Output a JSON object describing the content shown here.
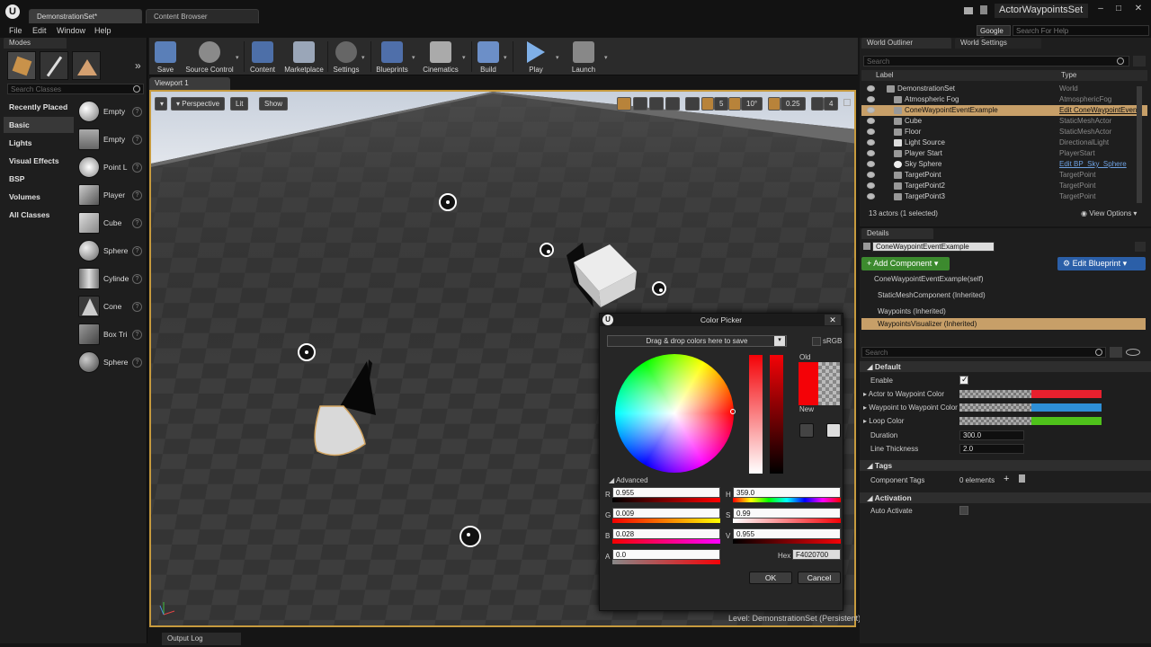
{
  "titlebar": {
    "tabs": [
      "DemonstrationSet*",
      "Content Browser"
    ],
    "project_name": "ActorWaypointsSet"
  },
  "menubar": {
    "items": [
      "File",
      "Edit",
      "Window",
      "Help"
    ],
    "google_label": "Google",
    "search_help_placeholder": "Search For Help"
  },
  "modes": {
    "tab_label": "Modes",
    "search_placeholder": "Search Classes",
    "categories": [
      "Recently Placed",
      "Basic",
      "Lights",
      "Visual Effects",
      "BSP",
      "Volumes",
      "All Classes"
    ],
    "items": [
      "Empty",
      "Empty",
      "Point L",
      "Player",
      "Cube",
      "Sphere",
      "Cylinde",
      "Cone",
      "Box Tri",
      "Sphere"
    ]
  },
  "toolbar": {
    "buttons": [
      "Save",
      "Source Control",
      "Content",
      "Marketplace",
      "Settings",
      "Blueprints",
      "Cinematics",
      "Build",
      "Play",
      "Launch"
    ]
  },
  "viewport": {
    "tab_label": "Viewport 1",
    "perspective_label": "Perspective",
    "lit_label": "Lit",
    "show_label": "Show",
    "grid_snap": "5",
    "rot_snap": "10°",
    "scale_snap": "0.25",
    "camera_speed": "4",
    "level_label": "Level:",
    "level_name": "DemonstrationSet (Persistent)"
  },
  "output_log": {
    "label": "Output Log"
  },
  "color_picker": {
    "title": "Color Picker",
    "drag_hint": "Drag & drop colors here to save",
    "srgb_label": "sRGB",
    "old_label": "Old",
    "new_label": "New",
    "advanced_label": "Advanced",
    "r_label": "R",
    "r_value": "0.955",
    "g_label": "G",
    "g_value": "0.009",
    "b_label": "B",
    "b_value": "0.028",
    "a_label": "A",
    "a_value": "0.0",
    "h_label": "H",
    "h_value": "359.0",
    "s_label": "S",
    "s_value": "0.99",
    "v_label": "V",
    "v_value": "0.955",
    "hex_label": "Hex",
    "hex_value": "F4020700",
    "ok_label": "OK",
    "cancel_label": "Cancel",
    "current_color": "#f40207"
  },
  "outliner": {
    "tabs": [
      "World Outliner",
      "World Settings"
    ],
    "search_placeholder": "Search",
    "col_label": "Label",
    "col_type": "Type",
    "rows": [
      {
        "label": "DemonstrationSet",
        "type": "World"
      },
      {
        "label": "Atmospheric Fog",
        "type": "AtmosphericFog"
      },
      {
        "label": "ConeWaypointEventExample",
        "type": "Edit ConeWaypointEvent"
      },
      {
        "label": "Cube",
        "type": "StaticMeshActor"
      },
      {
        "label": "Floor",
        "type": "StaticMeshActor"
      },
      {
        "label": "Light Source",
        "type": "DirectionalLight"
      },
      {
        "label": "Player Start",
        "type": "PlayerStart"
      },
      {
        "label": "Sky Sphere",
        "type": "Edit BP_Sky_Sphere"
      },
      {
        "label": "TargetPoint",
        "type": "TargetPoint"
      },
      {
        "label": "TargetPoint2",
        "type": "TargetPoint"
      },
      {
        "label": "TargetPoint3",
        "type": "TargetPoint"
      }
    ],
    "status": "13 actors (1 selected)",
    "view_options": "View Options"
  },
  "details": {
    "tab_label": "Details",
    "actor_name": "ConeWaypointEventExample",
    "add_component": "Add Component",
    "edit_blueprint": "Edit Blueprint",
    "components": [
      "ConeWaypointEventExample(self)",
      "StaticMeshComponent (Inherited)",
      "Waypoints (Inherited)",
      "WaypointsVisualizer (Inherited)"
    ],
    "search_placeholder": "Search",
    "sections": [
      "Default",
      "Tags",
      "Activation"
    ],
    "enable_label": "Enable",
    "actor_to_waypoint_label": "Actor to Waypoint Color",
    "waypoint_to_waypoint_label": "Waypoint to Waypoint Color",
    "loop_color_label": "Loop Color",
    "duration_label": "Duration",
    "duration_value": "300.0",
    "line_thickness_label": "Line Thickness",
    "line_thickness_value": "2.0",
    "component_tags_label": "Component Tags",
    "component_tags_value": "0 elements",
    "auto_activate_label": "Auto Activate",
    "colors": {
      "actor_to_waypoint": "#e8202e",
      "waypoint_to_waypoint": "#2e8fd6",
      "loop": "#4fc21b"
    }
  }
}
